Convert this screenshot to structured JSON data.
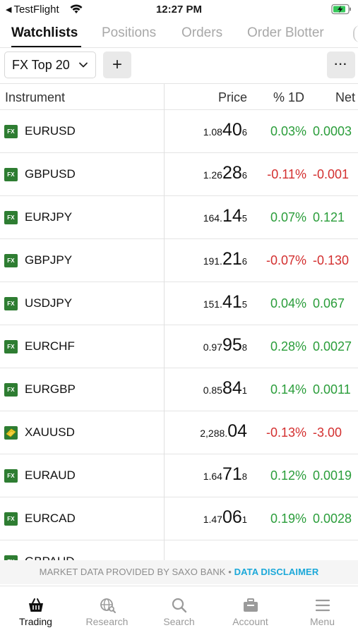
{
  "status_bar": {
    "back_label": "TestFlight",
    "time": "12:27 PM"
  },
  "tabs": [
    {
      "label": "Watchlists",
      "active": true
    },
    {
      "label": "Positions",
      "active": false
    },
    {
      "label": "Orders",
      "active": false
    },
    {
      "label": "Order Blotter",
      "active": false
    }
  ],
  "toolbar": {
    "watchlist_selected": "FX Top 20",
    "add_label": "+",
    "more_label": "···"
  },
  "table": {
    "headers": {
      "instrument": "Instrument",
      "price": "Price",
      "pct_1d": "% 1D",
      "net": "Net"
    },
    "rows": [
      {
        "symbol": "EURUSD",
        "icon": "fx-icon",
        "price_prefix": "1.08",
        "price_big": "40",
        "price_suffix": "6",
        "pct": "0.03%",
        "net": "0.0003",
        "direction": "up"
      },
      {
        "symbol": "GBPUSD",
        "icon": "fx-icon",
        "price_prefix": "1.26",
        "price_big": "28",
        "price_suffix": "6",
        "pct": "-0.11%",
        "net": "-0.001",
        "direction": "down"
      },
      {
        "symbol": "EURJPY",
        "icon": "fx-icon",
        "price_prefix": "164.",
        "price_big": "14",
        "price_suffix": "5",
        "pct": "0.07%",
        "net": "0.121",
        "direction": "up"
      },
      {
        "symbol": "GBPJPY",
        "icon": "fx-icon",
        "price_prefix": "191.",
        "price_big": "21",
        "price_suffix": "6",
        "pct": "-0.07%",
        "net": "-0.130",
        "direction": "down"
      },
      {
        "symbol": "USDJPY",
        "icon": "fx-icon",
        "price_prefix": "151.",
        "price_big": "41",
        "price_suffix": "5",
        "pct": "0.04%",
        "net": "0.067",
        "direction": "up"
      },
      {
        "symbol": "EURCHF",
        "icon": "fx-icon",
        "price_prefix": "0.97",
        "price_big": "95",
        "price_suffix": "8",
        "pct": "0.28%",
        "net": "0.0027",
        "direction": "up"
      },
      {
        "symbol": "EURGBP",
        "icon": "fx-icon",
        "price_prefix": "0.85",
        "price_big": "84",
        "price_suffix": "1",
        "pct": "0.14%",
        "net": "0.0011",
        "direction": "up"
      },
      {
        "symbol": "XAUUSD",
        "icon": "gold-icon",
        "price_prefix": "2,288.",
        "price_big": "04",
        "price_suffix": "",
        "pct": "-0.13%",
        "net": "-3.00",
        "direction": "down"
      },
      {
        "symbol": "EURAUD",
        "icon": "fx-icon",
        "price_prefix": "1.64",
        "price_big": "71",
        "price_suffix": "8",
        "pct": "0.12%",
        "net": "0.0019",
        "direction": "up"
      },
      {
        "symbol": "EURCAD",
        "icon": "fx-icon",
        "price_prefix": "1.47",
        "price_big": "06",
        "price_suffix": "1",
        "pct": "0.19%",
        "net": "0.0028",
        "direction": "up"
      },
      {
        "symbol": "GBPAUD",
        "icon": "fx-icon",
        "price_prefix": "",
        "price_big": "",
        "price_suffix": "",
        "pct": "",
        "net": "",
        "direction": "up"
      }
    ]
  },
  "disclaimer": {
    "text": "MARKET DATA PROVIDED BY SAXO BANK • ",
    "link": "DATA DISCLAIMER"
  },
  "bottom_nav": [
    {
      "label": "Trading",
      "icon": "basket-icon",
      "active": true
    },
    {
      "label": "Research",
      "icon": "globe-search-icon",
      "active": false
    },
    {
      "label": "Search",
      "icon": "search-icon",
      "active": false
    },
    {
      "label": "Account",
      "icon": "briefcase-icon",
      "active": false
    },
    {
      "label": "Menu",
      "icon": "hamburger-icon",
      "active": false
    }
  ],
  "colors": {
    "positive": "#2a9d3a",
    "negative": "#d32f2f",
    "fx_badge": "#2e7d32",
    "link": "#1ba8d9"
  }
}
